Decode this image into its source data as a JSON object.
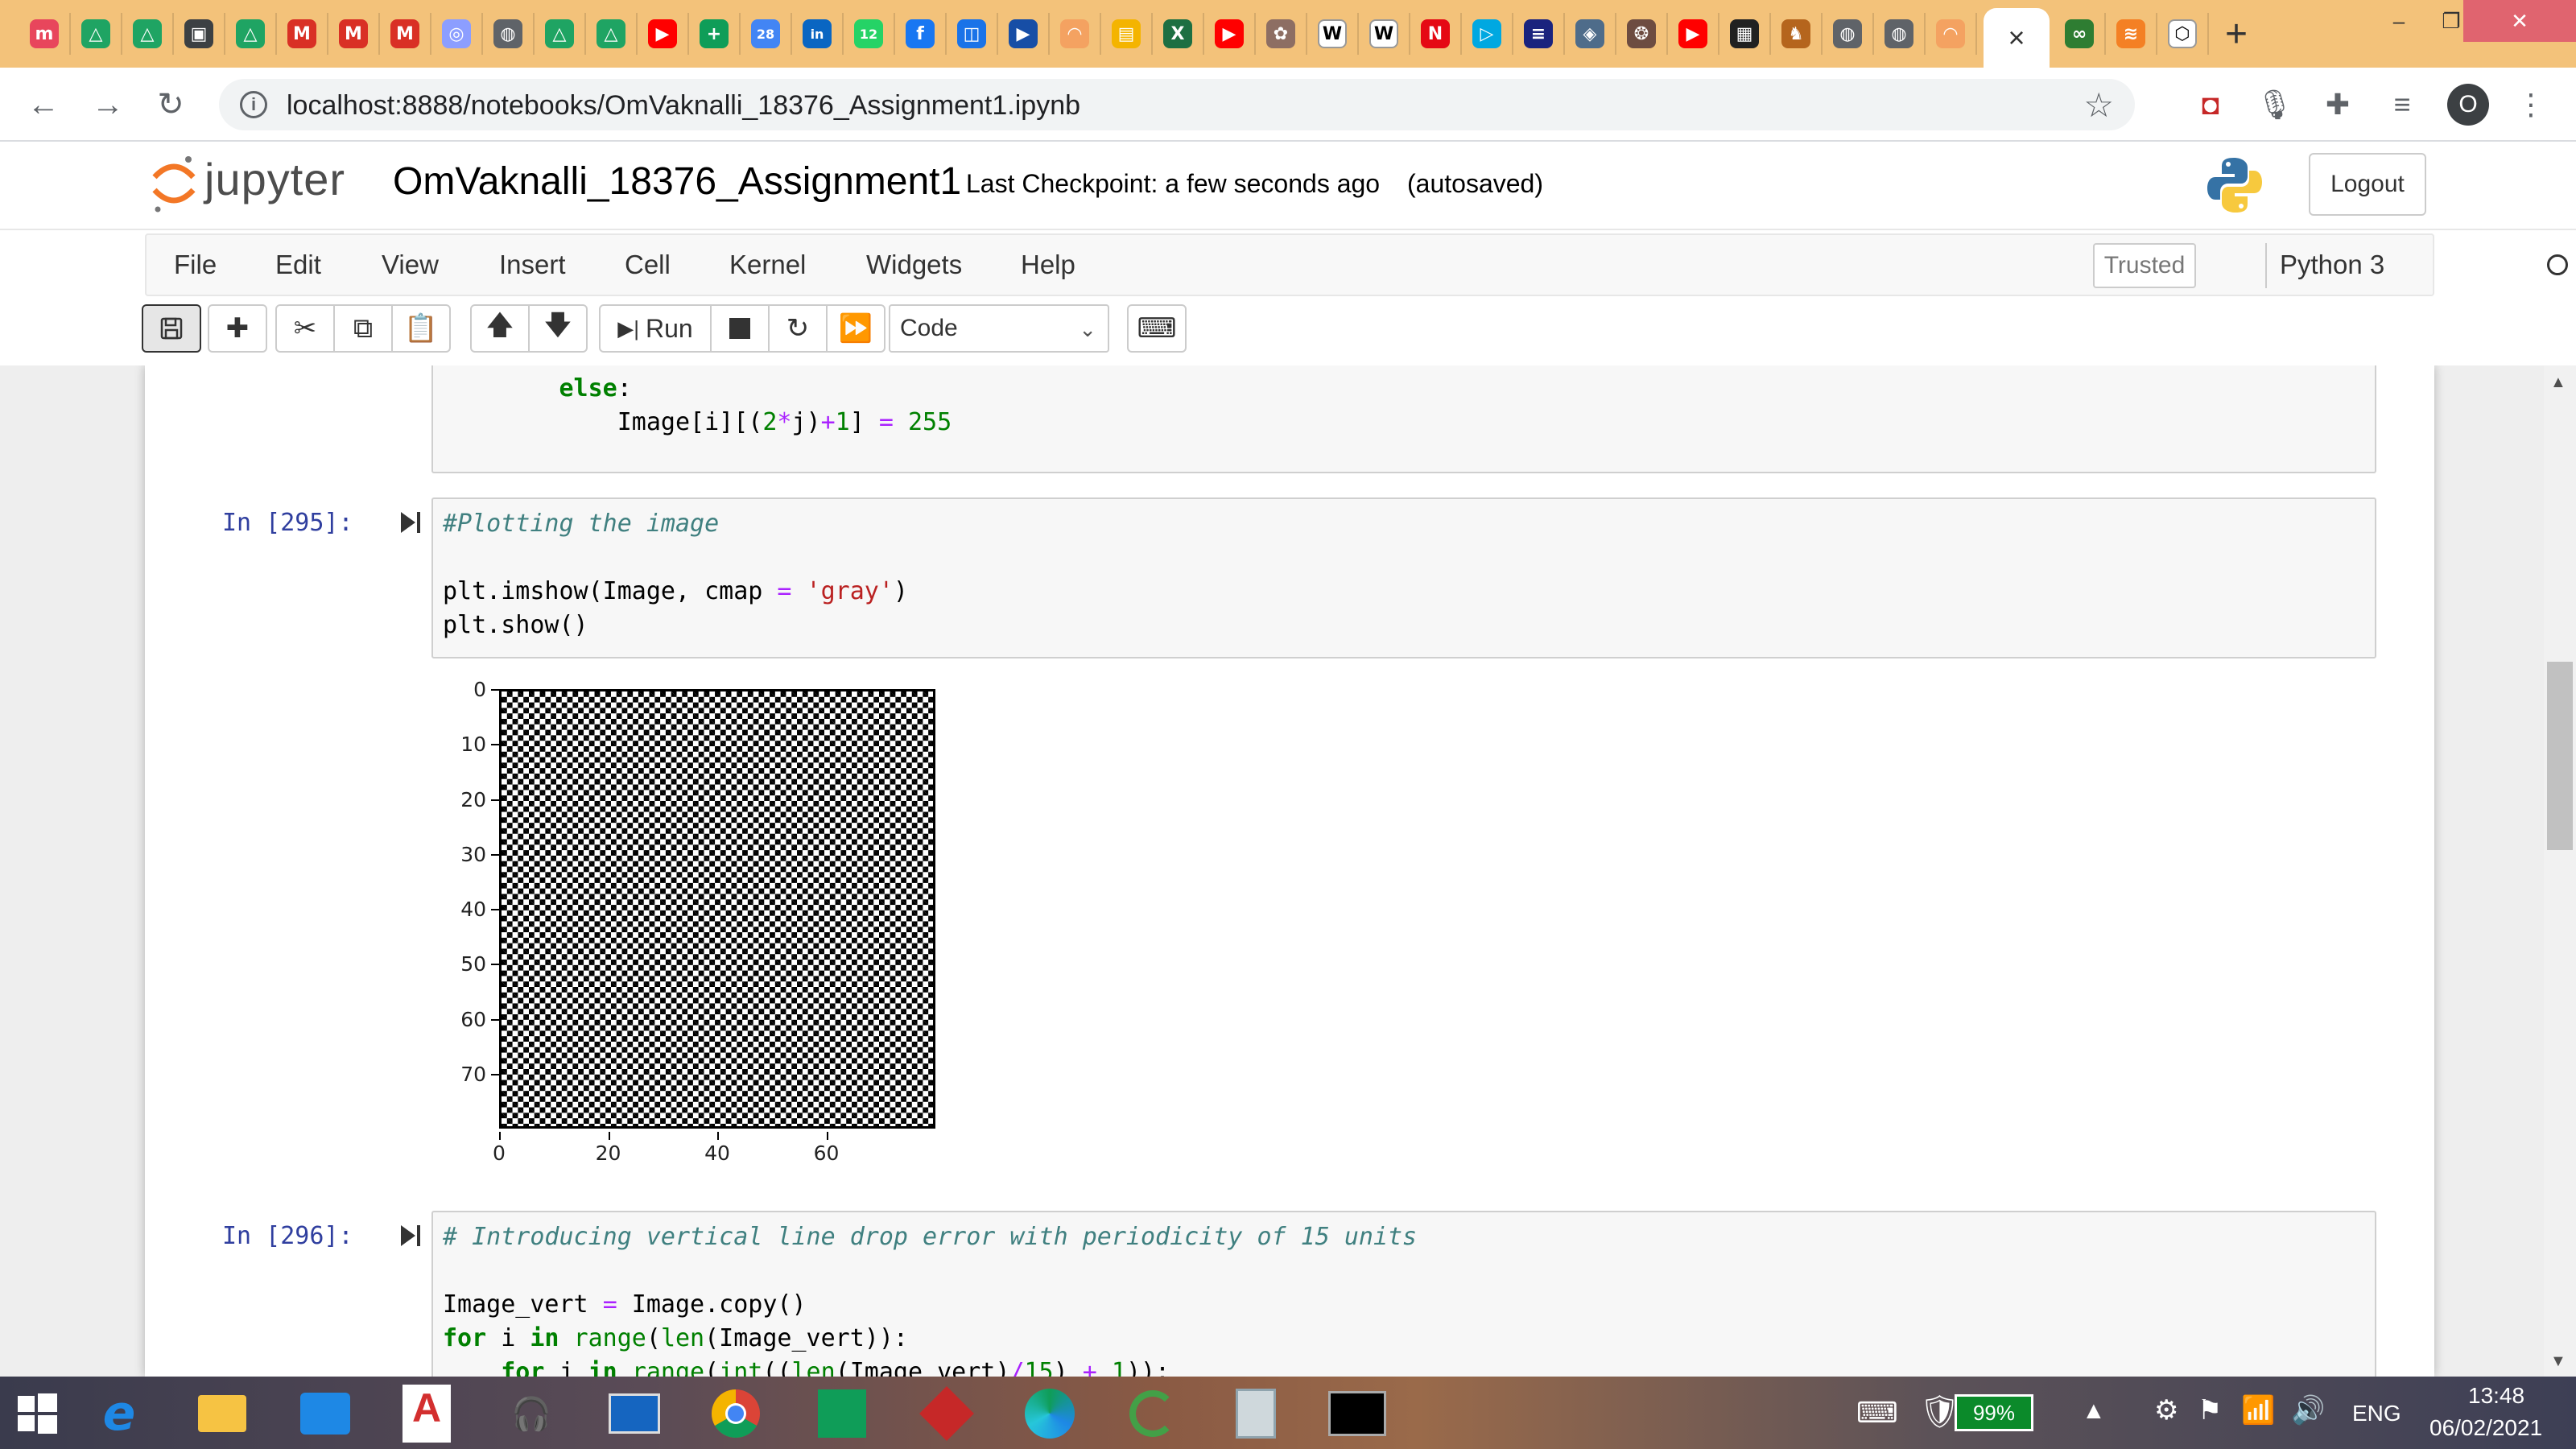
{
  "browser": {
    "active_tab_close": "×",
    "new_tab": "+",
    "url": "localhost:8888/notebooks/OmVaknalli_18376_Assignment1.ipynb",
    "profile_initial": "O",
    "tab_favicons": [
      {
        "name": "monday-icon",
        "color": "#e8465c",
        "glyph": "m"
      },
      {
        "name": "google-drive-icon",
        "color": "#1fa463",
        "glyph": "△"
      },
      {
        "name": "google-drive-icon",
        "color": "#1fa463",
        "glyph": "△"
      },
      {
        "name": "contacts-icon",
        "color": "#3c4043",
        "glyph": "▣"
      },
      {
        "name": "google-drive-icon",
        "color": "#1fa463",
        "glyph": "△"
      },
      {
        "name": "gmail-icon",
        "color": "#d93025",
        "glyph": "M"
      },
      {
        "name": "gmail-icon",
        "color": "#d93025",
        "glyph": "M"
      },
      {
        "name": "gmail-icon",
        "color": "#d93025",
        "glyph": "M"
      },
      {
        "name": "circle-app-icon",
        "color": "#8c9eff",
        "glyph": "◎"
      },
      {
        "name": "globe-icon",
        "color": "#5f6368",
        "glyph": "◍"
      },
      {
        "name": "google-drive-icon",
        "color": "#1fa463",
        "glyph": "△"
      },
      {
        "name": "google-drive-icon",
        "color": "#1fa463",
        "glyph": "△"
      },
      {
        "name": "youtube-icon",
        "color": "#ff0000",
        "glyph": "▶"
      },
      {
        "name": "plus-app-icon",
        "color": "#0f9d58",
        "glyph": "+"
      },
      {
        "name": "calendar-icon",
        "color": "#4285f4",
        "glyph": "28"
      },
      {
        "name": "linkedin-icon",
        "color": "#0a66c2",
        "glyph": "in"
      },
      {
        "name": "whatsapp-icon",
        "color": "#25d366",
        "glyph": "12"
      },
      {
        "name": "facebook-icon",
        "color": "#1877f2",
        "glyph": "f"
      },
      {
        "name": "meet-icon",
        "color": "#1a73e8",
        "glyph": "◫"
      },
      {
        "name": "play-icon",
        "color": "#174ea6",
        "glyph": "▶"
      },
      {
        "name": "loading-icon",
        "color": "#f4a261",
        "glyph": "◠"
      },
      {
        "name": "slides-icon",
        "color": "#f4b400",
        "glyph": "▤"
      },
      {
        "name": "excel-icon",
        "color": "#1d6f42",
        "glyph": "X"
      },
      {
        "name": "youtube-icon",
        "color": "#ff0000",
        "glyph": "▶"
      },
      {
        "name": "emblem-icon",
        "color": "#8d6e63",
        "glyph": "✿"
      },
      {
        "name": "wikipedia-icon",
        "color": "#ffffff",
        "glyph": "W"
      },
      {
        "name": "wikipedia-icon",
        "color": "#ffffff",
        "glyph": "W"
      },
      {
        "name": "netflix-icon",
        "color": "#e50914",
        "glyph": "N"
      },
      {
        "name": "media-play-icon",
        "color": "#00a8e1",
        "glyph": "▷"
      },
      {
        "name": "book-icon",
        "color": "#1a237e",
        "glyph": "≡"
      },
      {
        "name": "map-icon",
        "color": "#4e6c8a",
        "glyph": "◈"
      },
      {
        "name": "seal-icon",
        "color": "#6d4c41",
        "glyph": "❂"
      },
      {
        "name": "youtube-icon",
        "color": "#ff0000",
        "glyph": "▶"
      },
      {
        "name": "news-icon",
        "color": "#212121",
        "glyph": "▦"
      },
      {
        "name": "lion-icon",
        "color": "#b5651d",
        "glyph": "♞"
      },
      {
        "name": "globe-icon",
        "color": "#5f6368",
        "glyph": "◍"
      },
      {
        "name": "globe-icon",
        "color": "#5f6368",
        "glyph": "◍"
      },
      {
        "name": "loading-icon",
        "color": "#f4a261",
        "glyph": "◠"
      }
    ],
    "after_active_favicons": [
      {
        "name": "infinity-icon",
        "color": "#2e7d32",
        "glyph": "∞"
      },
      {
        "name": "stack-icon",
        "color": "#f48024",
        "glyph": "≋"
      },
      {
        "name": "box-icon",
        "color": "#ffffff",
        "glyph": "⬡"
      }
    ],
    "window_controls": {
      "minimize": "–",
      "restore": "❐",
      "close": "✕"
    }
  },
  "jupyter": {
    "logo_text": "jupyter",
    "notebook_name": "OmVaknalli_18376_Assignment1",
    "checkpoint": "Last Checkpoint: a few seconds ago",
    "autosave": "(autosaved)",
    "logout": "Logout",
    "menu": [
      "File",
      "Edit",
      "View",
      "Insert",
      "Cell",
      "Kernel",
      "Widgets",
      "Help"
    ],
    "trusted": "Trusted",
    "kernel": "Python 3",
    "toolbar": {
      "run": "Run",
      "cell_type": "Code"
    }
  },
  "cells": [
    {
      "prompt": "",
      "lines": [
        [
          [
            "k",
            "        else"
          ],
          [
            "",
            ":"
          ]
        ],
        [
          [
            "",
            "            Image[i][("
          ],
          [
            "n",
            "2"
          ],
          [
            "o",
            "*"
          ],
          [
            "",
            "j)"
          ],
          [
            "o",
            "+"
          ],
          [
            "n",
            "1"
          ],
          [
            "",
            "] "
          ],
          [
            "o",
            "="
          ],
          [
            "",
            " "
          ],
          [
            "n",
            "255"
          ]
        ]
      ]
    },
    {
      "prompt": "In [295]:",
      "lines": [
        [
          [
            "c",
            "#Plotting the image"
          ]
        ],
        [
          [
            "",
            ""
          ]
        ],
        [
          [
            "",
            "plt.imshow(Image, cmap "
          ],
          [
            "o",
            "="
          ],
          [
            "",
            " "
          ],
          [
            "s",
            "'gray'"
          ],
          [
            "",
            ")"
          ]
        ],
        [
          [
            "",
            "plt.show()"
          ]
        ]
      ]
    },
    {
      "prompt": "In [296]:",
      "lines": [
        [
          [
            "c",
            "# Introducing vertical line drop error with periodicity of 15 units"
          ]
        ],
        [
          [
            "",
            ""
          ]
        ],
        [
          [
            "",
            "Image_vert "
          ],
          [
            "o",
            "="
          ],
          [
            "",
            " Image.copy()"
          ]
        ],
        [
          [
            "k",
            "for"
          ],
          [
            "",
            " i "
          ],
          [
            "k",
            "in"
          ],
          [
            "",
            " "
          ],
          [
            "n",
            "range"
          ],
          [
            "",
            "("
          ],
          [
            "n",
            "len"
          ],
          [
            "",
            "(Image_vert)):"
          ]
        ],
        [
          [
            "",
            "    "
          ],
          [
            "k",
            "for"
          ],
          [
            "",
            " j "
          ],
          [
            "k",
            "in"
          ],
          [
            "",
            " "
          ],
          [
            "n",
            "range"
          ],
          [
            "",
            "("
          ],
          [
            "n",
            "int"
          ],
          [
            "",
            "(("
          ],
          [
            "n",
            "len"
          ],
          [
            "",
            "(Image_vert)"
          ],
          [
            "o",
            "/"
          ],
          [
            "n",
            "15"
          ],
          [
            "",
            ") "
          ],
          [
            "o",
            "+"
          ],
          [
            "",
            " "
          ],
          [
            "n",
            "1"
          ],
          [
            "",
            ")):"
          ]
        ]
      ]
    }
  ],
  "chart_data": {
    "type": "heatmap",
    "pattern": "checkerboard",
    "colormap": "gray",
    "title": "",
    "xlabel": "",
    "ylabel": "",
    "xlim": [
      0,
      80
    ],
    "ylim": [
      80,
      0
    ],
    "xticks": [
      0,
      20,
      40,
      60
    ],
    "yticks": [
      0,
      10,
      20,
      30,
      40,
      50,
      60,
      70
    ],
    "values": [
      0,
      255
    ]
  },
  "taskbar": {
    "battery": "99%",
    "language": "ENG",
    "time": "13:48",
    "date": "06/02/2021"
  }
}
